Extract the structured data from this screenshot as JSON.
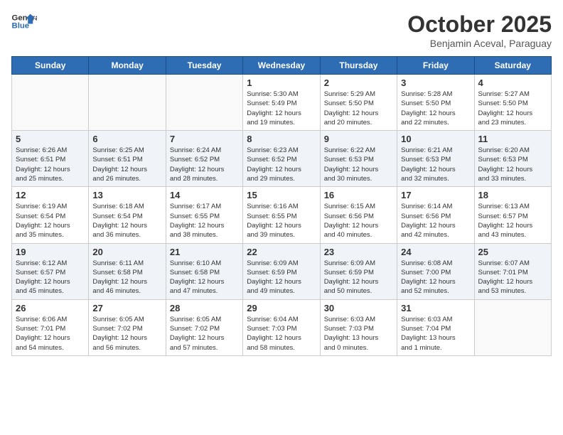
{
  "header": {
    "logo_line1": "General",
    "logo_line2": "Blue",
    "month": "October 2025",
    "location": "Benjamin Aceval, Paraguay"
  },
  "weekdays": [
    "Sunday",
    "Monday",
    "Tuesday",
    "Wednesday",
    "Thursday",
    "Friday",
    "Saturday"
  ],
  "weeks": [
    [
      {
        "day": "",
        "info": ""
      },
      {
        "day": "",
        "info": ""
      },
      {
        "day": "",
        "info": ""
      },
      {
        "day": "1",
        "info": "Sunrise: 5:30 AM\nSunset: 5:49 PM\nDaylight: 12 hours\nand 19 minutes."
      },
      {
        "day": "2",
        "info": "Sunrise: 5:29 AM\nSunset: 5:50 PM\nDaylight: 12 hours\nand 20 minutes."
      },
      {
        "day": "3",
        "info": "Sunrise: 5:28 AM\nSunset: 5:50 PM\nDaylight: 12 hours\nand 22 minutes."
      },
      {
        "day": "4",
        "info": "Sunrise: 5:27 AM\nSunset: 5:50 PM\nDaylight: 12 hours\nand 23 minutes."
      }
    ],
    [
      {
        "day": "5",
        "info": "Sunrise: 6:26 AM\nSunset: 6:51 PM\nDaylight: 12 hours\nand 25 minutes."
      },
      {
        "day": "6",
        "info": "Sunrise: 6:25 AM\nSunset: 6:51 PM\nDaylight: 12 hours\nand 26 minutes."
      },
      {
        "day": "7",
        "info": "Sunrise: 6:24 AM\nSunset: 6:52 PM\nDaylight: 12 hours\nand 28 minutes."
      },
      {
        "day": "8",
        "info": "Sunrise: 6:23 AM\nSunset: 6:52 PM\nDaylight: 12 hours\nand 29 minutes."
      },
      {
        "day": "9",
        "info": "Sunrise: 6:22 AM\nSunset: 6:53 PM\nDaylight: 12 hours\nand 30 minutes."
      },
      {
        "day": "10",
        "info": "Sunrise: 6:21 AM\nSunset: 6:53 PM\nDaylight: 12 hours\nand 32 minutes."
      },
      {
        "day": "11",
        "info": "Sunrise: 6:20 AM\nSunset: 6:53 PM\nDaylight: 12 hours\nand 33 minutes."
      }
    ],
    [
      {
        "day": "12",
        "info": "Sunrise: 6:19 AM\nSunset: 6:54 PM\nDaylight: 12 hours\nand 35 minutes."
      },
      {
        "day": "13",
        "info": "Sunrise: 6:18 AM\nSunset: 6:54 PM\nDaylight: 12 hours\nand 36 minutes."
      },
      {
        "day": "14",
        "info": "Sunrise: 6:17 AM\nSunset: 6:55 PM\nDaylight: 12 hours\nand 38 minutes."
      },
      {
        "day": "15",
        "info": "Sunrise: 6:16 AM\nSunset: 6:55 PM\nDaylight: 12 hours\nand 39 minutes."
      },
      {
        "day": "16",
        "info": "Sunrise: 6:15 AM\nSunset: 6:56 PM\nDaylight: 12 hours\nand 40 minutes."
      },
      {
        "day": "17",
        "info": "Sunrise: 6:14 AM\nSunset: 6:56 PM\nDaylight: 12 hours\nand 42 minutes."
      },
      {
        "day": "18",
        "info": "Sunrise: 6:13 AM\nSunset: 6:57 PM\nDaylight: 12 hours\nand 43 minutes."
      }
    ],
    [
      {
        "day": "19",
        "info": "Sunrise: 6:12 AM\nSunset: 6:57 PM\nDaylight: 12 hours\nand 45 minutes."
      },
      {
        "day": "20",
        "info": "Sunrise: 6:11 AM\nSunset: 6:58 PM\nDaylight: 12 hours\nand 46 minutes."
      },
      {
        "day": "21",
        "info": "Sunrise: 6:10 AM\nSunset: 6:58 PM\nDaylight: 12 hours\nand 47 minutes."
      },
      {
        "day": "22",
        "info": "Sunrise: 6:09 AM\nSunset: 6:59 PM\nDaylight: 12 hours\nand 49 minutes."
      },
      {
        "day": "23",
        "info": "Sunrise: 6:09 AM\nSunset: 6:59 PM\nDaylight: 12 hours\nand 50 minutes."
      },
      {
        "day": "24",
        "info": "Sunrise: 6:08 AM\nSunset: 7:00 PM\nDaylight: 12 hours\nand 52 minutes."
      },
      {
        "day": "25",
        "info": "Sunrise: 6:07 AM\nSunset: 7:01 PM\nDaylight: 12 hours\nand 53 minutes."
      }
    ],
    [
      {
        "day": "26",
        "info": "Sunrise: 6:06 AM\nSunset: 7:01 PM\nDaylight: 12 hours\nand 54 minutes."
      },
      {
        "day": "27",
        "info": "Sunrise: 6:05 AM\nSunset: 7:02 PM\nDaylight: 12 hours\nand 56 minutes."
      },
      {
        "day": "28",
        "info": "Sunrise: 6:05 AM\nSunset: 7:02 PM\nDaylight: 12 hours\nand 57 minutes."
      },
      {
        "day": "29",
        "info": "Sunrise: 6:04 AM\nSunset: 7:03 PM\nDaylight: 12 hours\nand 58 minutes."
      },
      {
        "day": "30",
        "info": "Sunrise: 6:03 AM\nSunset: 7:03 PM\nDaylight: 13 hours\nand 0 minutes."
      },
      {
        "day": "31",
        "info": "Sunrise: 6:03 AM\nSunset: 7:04 PM\nDaylight: 13 hours\nand 1 minute."
      },
      {
        "day": "",
        "info": ""
      }
    ]
  ]
}
